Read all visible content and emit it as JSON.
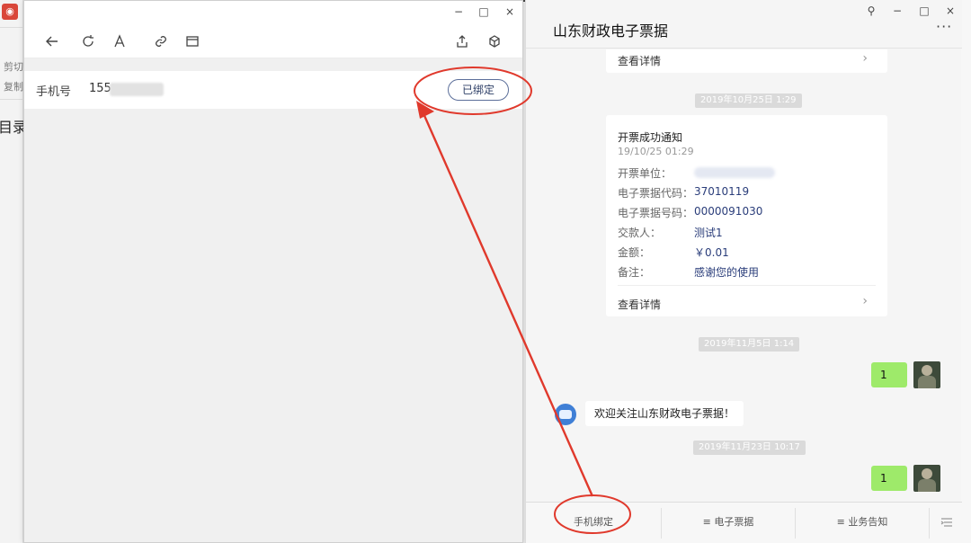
{
  "background_window": {
    "logo_glyph": "◉",
    "fragments": [
      "剪切",
      "复制",
      "目录"
    ]
  },
  "left_window": {
    "controls": {
      "minimize": "−",
      "maximize": "□",
      "close": "×"
    },
    "phone_row": {
      "label": "手机号",
      "value": "155",
      "bound_button": "已绑定"
    }
  },
  "right_window": {
    "title": "山东财政电子票据",
    "more": "···",
    "controls": {
      "pin": "⚲",
      "minimize": "−",
      "maximize": "□",
      "close": "×"
    },
    "messages": {
      "top_card_link": "查看详情",
      "time_1": "2019年10月25日 1:29",
      "invoice_card": {
        "title": "开票成功通知",
        "time": "19/10/25 01:29",
        "fields": [
          {
            "label": "开票单位：",
            "value": ""
          },
          {
            "label": "电子票据代码：",
            "value": "37010119"
          },
          {
            "label": "电子票据号码：",
            "value": "0000091030"
          },
          {
            "label": "交款人：",
            "value": "测试1"
          },
          {
            "label": "金额：",
            "value": "￥0.01"
          },
          {
            "label": "备注：",
            "value": "感谢您的使用"
          }
        ],
        "link": "查看详情"
      },
      "time_2": "2019年11月5日 1:14",
      "my_message_1": "1",
      "bot_message": "欢迎关注山东财政电子票据！",
      "time_3": "2019年11月23日 10:17",
      "my_message_2": "1"
    },
    "bottom_menu": [
      {
        "label": "手机绑定"
      },
      {
        "label": "≡ 电子票据"
      },
      {
        "label": "≡ 业务告知"
      }
    ]
  },
  "colors": {
    "annotation_red": "#e0392c",
    "my_bubble": "#9eea6a",
    "value_blue": "#2a3d7a"
  }
}
